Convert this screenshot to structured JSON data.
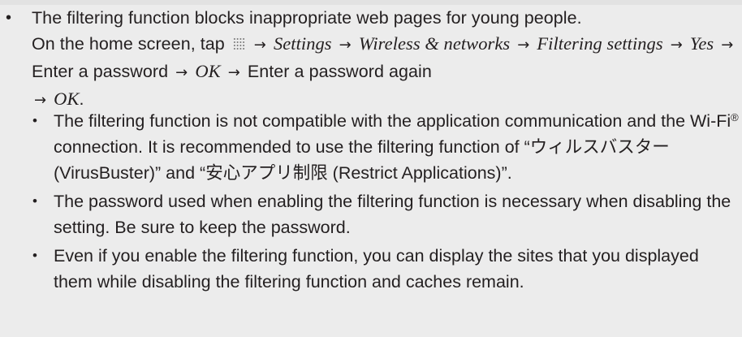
{
  "main_bullet": {
    "bullet": "•",
    "line1": "The filtering function blocks inappropriate web pages for young people.",
    "seg_on_home": "On the home screen, tap",
    "icon_name": "apps-grid-icon",
    "arrow": "→",
    "step_settings": "Settings",
    "step_wireless": "Wireless & networks",
    "step_filtering": "Filtering settings",
    "step_yes": "Yes",
    "step_enter_pw": "Enter a password",
    "step_ok": "OK",
    "step_enter_pw_again": "Enter a password again",
    "end_period": "."
  },
  "sub_bullets": [
    {
      "bullet": "•",
      "part1": "The filtering function is not compatible with the application communication and the Wi-Fi",
      "reg": "®",
      "part2": " connection. It is recommended to use the filtering function of “ウィルスバスター (VirusBuster)” and “安心アプリ制限 (Restrict Applications)”."
    },
    {
      "bullet": "•",
      "text": "The password used when enabling the filtering function is necessary when disabling the setting. Be sure to keep the password."
    },
    {
      "bullet": "•",
      "text": "Even if you enable the filtering function, you can display the sites that you displayed them while disabling the filtering function and caches remain."
    }
  ]
}
